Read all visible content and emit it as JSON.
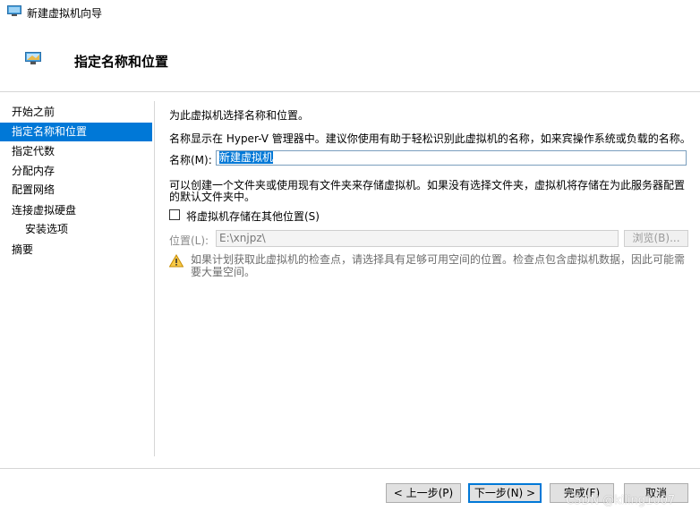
{
  "window": {
    "title": "新建虚拟机向导"
  },
  "header": {
    "title": "指定名称和位置"
  },
  "sidebar": {
    "items": [
      {
        "label": "开始之前"
      },
      {
        "label": "指定名称和位置"
      },
      {
        "label": "指定代数"
      },
      {
        "label": "分配内存"
      },
      {
        "label": "配置网络"
      },
      {
        "label": "连接虚拟硬盘"
      },
      {
        "label": "安装选项"
      },
      {
        "label": "摘要"
      }
    ]
  },
  "main": {
    "intro": "为此虚拟机选择名称和位置。",
    "description": "名称显示在 Hyper-V 管理器中。建议你使用有助于轻松识别此虚拟机的名称，如来宾操作系统或负载的名称。",
    "name_label": "名称(M):",
    "name_value": "新建虚拟机",
    "folder_text_1": "可以创建一个文件夹或使用现有文件夹来存储虚拟机。如果没有选择文件夹，虚拟机将存储在为此服务器配置",
    "folder_text_2": "的默认文件夹中。",
    "store_checkbox_label": "将虚拟机存储在其他位置(S)",
    "store_checked": false,
    "location_label": "位置(L):",
    "location_value": "E:\\xnjpz\\",
    "browse_label": "浏览(B)...",
    "warning_text": "如果计划获取此虚拟机的检查点，请选择具有足够可用空间的位置。检查点包含虚拟机数据，因此可能需要大量空间。"
  },
  "footer": {
    "prev_label": "< 上一步(P)",
    "next_label": "下一步(N) >",
    "finish_label": "完成(F)",
    "cancel_label": "取消"
  },
  "watermark": "CSDN @kiling1007",
  "colors": {
    "accent": "#0078d7",
    "warning": "#e6a817"
  }
}
